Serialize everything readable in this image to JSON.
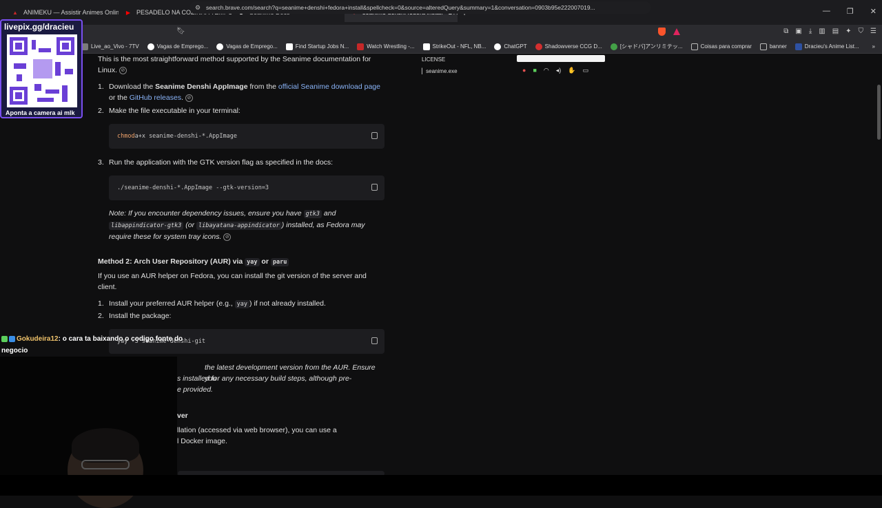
{
  "tabs": [
    {
      "label": "ANIMEKU — Assistir Animes Online G",
      "fav_color": "#c62828",
      "fav_char": "A"
    },
    {
      "label": "PESADELO NA COZINHA TEMPORADA",
      "fav_color": "#ff0000",
      "fav_char": "▶"
    },
    {
      "label": "Seanime Docs",
      "fav_color": "#1c1c1f",
      "fav_char": "S"
    },
    {
      "label": "seanime denshi fedora install - B",
      "fav_color": "#e04848",
      "fav_char": "●"
    }
  ],
  "url": "search.brave.com/search?q=seanime+denshi+fedora+install&spellcheck=0&source=alteredQuery&summary=1&conversation=0903b95e222007019...",
  "bookmarks": [
    {
      "label": "Live_ao_Vivo - 7TV",
      "color": "#7b7b7b"
    },
    {
      "label": "Vagas de Emprego...",
      "color": "#ffffff"
    },
    {
      "label": "Vagas de Emprego...",
      "color": "#ffffff"
    },
    {
      "label": "Find Startup Jobs N...",
      "color": "#ffffff"
    },
    {
      "label": "Watch Wrestling -...",
      "color": "#c62828"
    },
    {
      "label": "StrikeOut - NFL, NB...",
      "color": "#ffffff"
    },
    {
      "label": "ChatGPT",
      "color": "#ffffff"
    },
    {
      "label": "Shadowverse CCG D...",
      "color": "#d32f2f"
    },
    {
      "label": "[シャドバ]アンリミテッ...",
      "color": "#43a047"
    },
    {
      "label": "Coisas para comprar",
      "color": "folder"
    },
    {
      "label": "banner",
      "color": "folder"
    },
    {
      "label": "Dracieu's Anime List...",
      "color": "#2e51a2"
    }
  ],
  "content": {
    "intro": "This is the most straightforward method supported by the Seanime documentation for Linux.",
    "m1_step1_a": "Download the ",
    "m1_step1_b": "Seanime Denshi AppImage",
    "m1_step1_c": " from the ",
    "m1_step1_link1": "official Seanime download page",
    "m1_step1_d": " or the ",
    "m1_step1_link2": "GitHub releases",
    "m1_step1_e": ".",
    "m1_step2": "Make the file executable in your terminal:",
    "code1_kw": "chmod",
    "code1_rest": " a+x seanime-denshi-*.AppImage",
    "m1_step3": "Run the application with the GTK version flag as specified in the docs:",
    "code2": "./seanime-denshi-*.AppImage --gtk-version=3",
    "note_a": "Note: If you encounter dependency issues, ensure you have ",
    "note_code1": "gtk3",
    "note_b": " and",
    "note_code2": "libappindicator-gtk3",
    "note_c": " (or ",
    "note_code3": "libayatana-appindicator",
    "note_d": ") installed, as Fedora may",
    "note_e": "require these for system tray icons.",
    "m2_title_a": "Method 2: Arch User Repository (AUR) via ",
    "m2_code_yay": "yay",
    "m2_title_or": " or ",
    "m2_code_paru": "paru",
    "m2_desc": "If you use an AUR helper on Fedora, you can install the git version of the server and client.",
    "m2_step1_a": "Install your preferred AUR helper (e.g., ",
    "m2_step1_code": "yay",
    "m2_step1_b": ") if not already installed.",
    "m2_step2": "Install the package:",
    "code3": "yay -S seanime-denshi-git",
    "partial1": "the latest development version from the AUR. Ensure you",
    "partial2": "s  installed for any necessary build steps, although pre-",
    "partial3": "e provided.",
    "partial4": "ver",
    "partial5": "llation (accessed via web browser), you can use a",
    "partial6": "l Docker image."
  },
  "side": {
    "license": "LICENSE",
    "exe": "seanime.exe"
  },
  "overlay": {
    "qr_title": "livepix.gg/dracieu",
    "qr_caption": "Aponta a camera ai mlk",
    "chat_user": "Gokudeira12",
    "chat_msg": ": o cara ta baixando o codigo fonte do negocio"
  },
  "colors": {
    "link": "#8ab4f8",
    "accent_purple": "#7a4ff0",
    "brave_orange": "#fb542b"
  }
}
